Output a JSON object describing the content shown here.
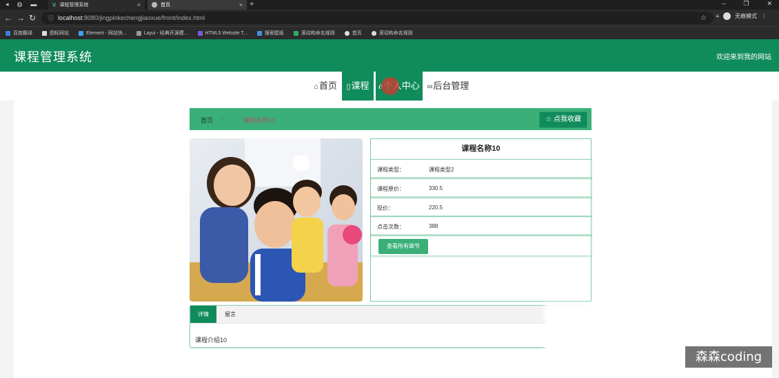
{
  "browser": {
    "tabs": [
      {
        "title": "课程管理系统",
        "active": false
      },
      {
        "title": "首页",
        "active": true
      }
    ],
    "url_host": "localhost",
    "url_rest": ":8080/jingpinkechengjiaoxue/front/index.html",
    "profile_label": "无痕模式",
    "bookmarks": [
      "百度翻译",
      "图标网站",
      "Element - 网站快...",
      "Layui - 经典开源模...",
      "HTML5 Website T...",
      "搜索壁纸",
      "滚动构命名规则",
      "首页",
      "滚动构命名规则"
    ]
  },
  "header": {
    "site_title": "课程管理系统",
    "welcome": "欢迎来到我的网站",
    "brand_color": "#108b5c"
  },
  "nav": {
    "items": [
      {
        "label": "首页",
        "icon": "home-icon",
        "active": false
      },
      {
        "label": "课程",
        "icon": "file-icon",
        "active": true
      },
      {
        "label": "个人中心",
        "icon": "user-icon",
        "active": false
      },
      {
        "label": "后台管理",
        "icon": "link-icon",
        "active": false
      }
    ]
  },
  "breadcrumb": {
    "home": "首页",
    "separator": "/",
    "current": "课程名称10",
    "favorite_button": "点我收藏"
  },
  "course": {
    "title": "课程名称10",
    "fields": [
      {
        "label": "课程类型：",
        "value": "课程类型2"
      },
      {
        "label": "课程原价：",
        "value": "330.5"
      },
      {
        "label": "现价：",
        "value": "220.5"
      },
      {
        "label": "点击次数：",
        "value": "388"
      }
    ],
    "chapters_button": "查看所有章节"
  },
  "tabs": {
    "detail": "详情",
    "message": "留言",
    "intro": "课程介绍10"
  },
  "watermark": "森森coding"
}
